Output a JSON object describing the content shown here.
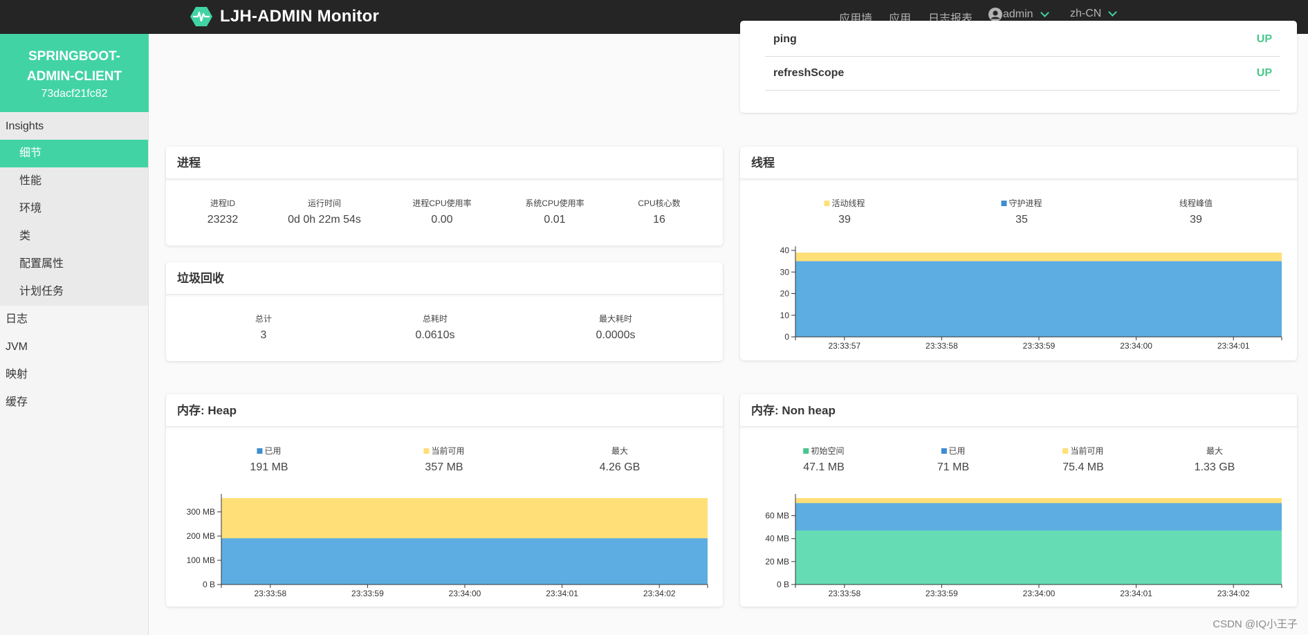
{
  "navbar": {
    "title": "LJH-ADMIN Monitor",
    "links": [
      "应用墙",
      "应用",
      "日志报表"
    ],
    "user": "admin",
    "language": "zh-CN",
    "accent": "#42d3a5"
  },
  "sidebar": {
    "app_name": "SPRINGBOOT-ADMIN-CLIENT",
    "app_id": "73dacf21fc82",
    "section": "Insights",
    "insights_items": [
      "细节",
      "性能",
      "环境",
      "类",
      "配置属性",
      "计划任务"
    ],
    "active_item": "细节",
    "items": [
      "日志",
      "JVM",
      "映射",
      "缓存"
    ]
  },
  "health": {
    "rows": [
      {
        "name": "ping",
        "status": "UP"
      },
      {
        "name": "refreshScope",
        "status": "UP"
      }
    ]
  },
  "process": {
    "title": "进程",
    "stats": [
      {
        "label": "进程ID",
        "value": "23232"
      },
      {
        "label": "运行时间",
        "value": "0d 0h 22m 54s"
      },
      {
        "label": "进程CPU使用率",
        "value": "0.00"
      },
      {
        "label": "系统CPU使用率",
        "value": "0.01"
      },
      {
        "label": "CPU核心数",
        "value": "16"
      }
    ]
  },
  "gc": {
    "title": "垃圾回收",
    "stats": [
      {
        "label": "总计",
        "value": "3"
      },
      {
        "label": "总耗时",
        "value": "0.0610s"
      },
      {
        "label": "最大耗时",
        "value": "0.0000s"
      }
    ]
  },
  "threads": {
    "title": "线程",
    "stats": [
      {
        "label": "活动线程",
        "value": "39",
        "color": "#ffe078"
      },
      {
        "label": "守护进程",
        "value": "35",
        "color": "#3e8ed0"
      },
      {
        "label": "线程峰值",
        "value": "39",
        "color": ""
      }
    ]
  },
  "heap": {
    "title": "内存: Heap",
    "stats": [
      {
        "label": "已用",
        "value": "191 MB",
        "color": "#3e8ed0"
      },
      {
        "label": "当前可用",
        "value": "357 MB",
        "color": "#ffe078"
      },
      {
        "label": "最大",
        "value": "4.26 GB",
        "color": ""
      }
    ]
  },
  "nonheap": {
    "title": "内存: Non heap",
    "stats": [
      {
        "label": "初始空间",
        "value": "47.1 MB",
        "color": "#48c78e"
      },
      {
        "label": "已用",
        "value": "71 MB",
        "color": "#3e8ed0"
      },
      {
        "label": "当前可用",
        "value": "75.4 MB",
        "color": "#ffe078"
      },
      {
        "label": "最大",
        "value": "1.33 GB",
        "color": ""
      }
    ]
  },
  "chart_data": [
    {
      "type": "area",
      "name": "threads",
      "x": [
        "23:33:57",
        "23:33:58",
        "23:33:59",
        "23:34:00",
        "23:34:01"
      ],
      "series": [
        {
          "name": "守护进程",
          "values": [
            35,
            35,
            35,
            35,
            35
          ],
          "color": "#5dade2"
        },
        {
          "name": "活动线程",
          "values": [
            39,
            39,
            39,
            39,
            39
          ],
          "color": "#ffe078"
        }
      ],
      "yticks": [
        "0",
        "10",
        "20",
        "30",
        "40"
      ],
      "ylim": [
        0,
        40
      ]
    },
    {
      "type": "area",
      "name": "heap",
      "x": [
        "23:33:58",
        "23:33:59",
        "23:34:00",
        "23:34:01",
        "23:34:02"
      ],
      "series": [
        {
          "name": "已用",
          "values": [
            191,
            191,
            191,
            191,
            191
          ],
          "color": "#5dade2"
        },
        {
          "name": "当前可用",
          "values": [
            357,
            357,
            357,
            357,
            357
          ],
          "color": "#ffe078"
        }
      ],
      "yticks": [
        "0 B",
        "100 MB",
        "200 MB",
        "300 MB"
      ],
      "ylim": [
        0,
        357
      ]
    },
    {
      "type": "area",
      "name": "nonheap",
      "x": [
        "23:33:58",
        "23:33:59",
        "23:34:00",
        "23:34:01",
        "23:34:02"
      ],
      "series": [
        {
          "name": "初始空间",
          "values": [
            47.1,
            47.1,
            47.1,
            47.1,
            47.1
          ],
          "color": "#66dcb5"
        },
        {
          "name": "已用",
          "values": [
            71,
            71,
            71,
            71,
            71
          ],
          "color": "#5dade2"
        },
        {
          "name": "当前可用",
          "values": [
            75.4,
            75.4,
            75.4,
            75.4,
            75.4
          ],
          "color": "#ffe078"
        }
      ],
      "yticks": [
        "0 B",
        "20 MB",
        "40 MB",
        "60 MB"
      ],
      "ylim": [
        0,
        75.4
      ]
    }
  ],
  "watermark": "CSDN @IQ小王子"
}
